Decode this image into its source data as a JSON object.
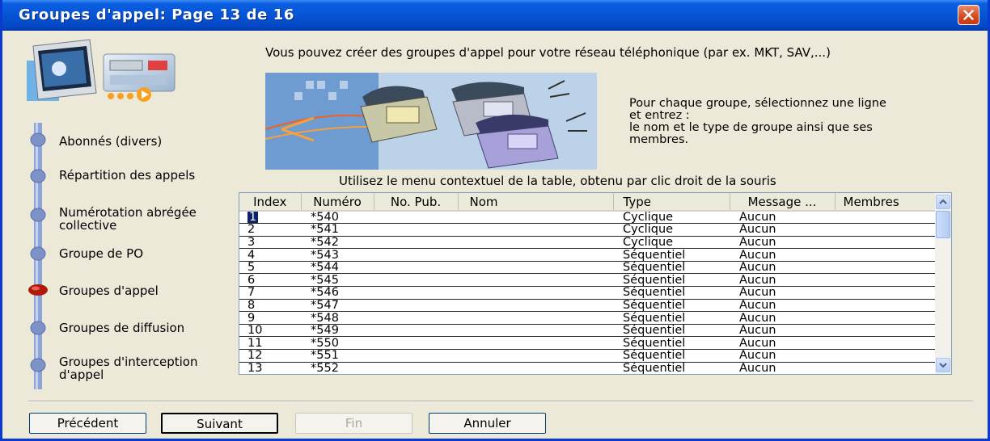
{
  "window": {
    "title": "Groupes d'appel: Page 13 de 16"
  },
  "intro_text": "Vous pouvez créer des groupes d'appel pour votre réseau téléphonique (par ex. MKT, SAV,...)",
  "instructions": {
    "line1": "Pour chaque groupe, sélectionnez une ligne",
    "line2": "et entrez :",
    "line3": "le nom et le type de groupe ainsi que ses",
    "line4": "membres."
  },
  "hint": "Utilisez le menu contextuel de la table, obtenu par clic droit de la souris",
  "steps": [
    {
      "label": "Abonnés (divers)",
      "active": false
    },
    {
      "label": "Répartition des appels",
      "active": false
    },
    {
      "label": "Numérotation abrégée collective",
      "active": false
    },
    {
      "label": "Groupe de PO",
      "active": false
    },
    {
      "label": "Groupes d'appel",
      "active": true
    },
    {
      "label": "Groupes de diffusion",
      "active": false
    },
    {
      "label": "Groupes d'interception d'appel",
      "active": false
    }
  ],
  "table": {
    "columns": [
      "Index",
      "Numéro",
      "No. Pub.",
      "Nom",
      "Type",
      "Message ...",
      "Membres"
    ],
    "rows": [
      {
        "index": "1",
        "numero": "*540",
        "pub": "",
        "nom": "",
        "type": "Cyclique",
        "message": "Aucun",
        "membres": ""
      },
      {
        "index": "2",
        "numero": "*541",
        "pub": "",
        "nom": "",
        "type": "Cyclique",
        "message": "Aucun",
        "membres": ""
      },
      {
        "index": "3",
        "numero": "*542",
        "pub": "",
        "nom": "",
        "type": "Cyclique",
        "message": "Aucun",
        "membres": ""
      },
      {
        "index": "4",
        "numero": "*543",
        "pub": "",
        "nom": "",
        "type": "Séquentiel",
        "message": "Aucun",
        "membres": ""
      },
      {
        "index": "5",
        "numero": "*544",
        "pub": "",
        "nom": "",
        "type": "Séquentiel",
        "message": "Aucun",
        "membres": ""
      },
      {
        "index": "6",
        "numero": "*545",
        "pub": "",
        "nom": "",
        "type": "Séquentiel",
        "message": "Aucun",
        "membres": ""
      },
      {
        "index": "7",
        "numero": "*546",
        "pub": "",
        "nom": "",
        "type": "Séquentiel",
        "message": "Aucun",
        "membres": ""
      },
      {
        "index": "8",
        "numero": "*547",
        "pub": "",
        "nom": "",
        "type": "Séquentiel",
        "message": "Aucun",
        "membres": ""
      },
      {
        "index": "9",
        "numero": "*548",
        "pub": "",
        "nom": "",
        "type": "Séquentiel",
        "message": "Aucun",
        "membres": ""
      },
      {
        "index": "10",
        "numero": "*549",
        "pub": "",
        "nom": "",
        "type": "Séquentiel",
        "message": "Aucun",
        "membres": ""
      },
      {
        "index": "11",
        "numero": "*550",
        "pub": "",
        "nom": "",
        "type": "Séquentiel",
        "message": "Aucun",
        "membres": ""
      },
      {
        "index": "12",
        "numero": "*551",
        "pub": "",
        "nom": "",
        "type": "Séquentiel",
        "message": "Aucun",
        "membres": ""
      },
      {
        "index": "13",
        "numero": "*552",
        "pub": "",
        "nom": "",
        "type": "Séquentiel",
        "message": "Aucun",
        "membres": ""
      }
    ]
  },
  "buttons": {
    "previous": "Précédent",
    "next": "Suivant",
    "finish": "Fin",
    "cancel": "Annuler"
  },
  "colors": {
    "titlebar": "#0654d4",
    "dialog_bg": "#ece9d8",
    "active_step": "#b01808",
    "step_rail": "#8fa4d6"
  },
  "icons": [
    "computer-logo-icon",
    "telephones-illustration",
    "close-icon",
    "scroll-up-icon",
    "scroll-down-icon"
  ]
}
